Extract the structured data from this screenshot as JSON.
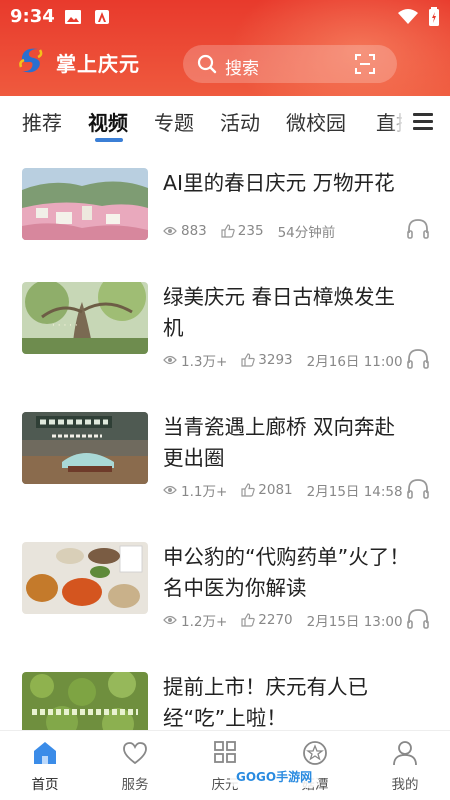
{
  "status_bar": {
    "time": "9:34"
  },
  "app_bar": {
    "title": "掌上庆元",
    "search": {
      "placeholder": "搜索"
    }
  },
  "tabs": [
    {
      "label": "推荐"
    },
    {
      "label": "视频",
      "active": true
    },
    {
      "label": "专题"
    },
    {
      "label": "活动"
    },
    {
      "label": "微校园"
    },
    {
      "label": "直播"
    }
  ],
  "articles": [
    {
      "title_lines": [
        "AI里的春日庆元 万物开花"
      ],
      "views": "883",
      "likes": "235",
      "time": "54分钟前"
    },
    {
      "title_lines": [
        "绿美庆元 春日古樟焕发生",
        "机"
      ],
      "views": "1.3万+",
      "likes": "3293",
      "time": "2月16日 11:00"
    },
    {
      "title_lines": [
        "当青瓷遇上廊桥 双向奔赴",
        "更出圈"
      ],
      "views": "1.1万+",
      "likes": "2081",
      "time": "2月15日 14:58"
    },
    {
      "title_lines": [
        "申公豹的“代购药单”火了！",
        "名中医为你解读"
      ],
      "views": "1.2万+",
      "likes": "2270",
      "time": "2月15日 13:00"
    },
    {
      "title_lines": [
        "提前上市！庆元有人已",
        "经“吃”上啦！"
      ],
      "views": "",
      "likes": "",
      "time": ""
    }
  ],
  "bottom_nav": [
    {
      "label": "首页",
      "icon": "home-icon",
      "active": true
    },
    {
      "label": "服务",
      "icon": "heart-icon"
    },
    {
      "label": "庆元",
      "icon": "grid-icon"
    },
    {
      "label": "菇潭",
      "icon": "star-circle-icon"
    },
    {
      "label": "我的",
      "icon": "user-icon"
    }
  ],
  "watermark": "GOGO手游网",
  "colors": {
    "header_red": "#e83a2c",
    "accent_blue": "#3b7fd6",
    "meta_gray": "#888888"
  }
}
